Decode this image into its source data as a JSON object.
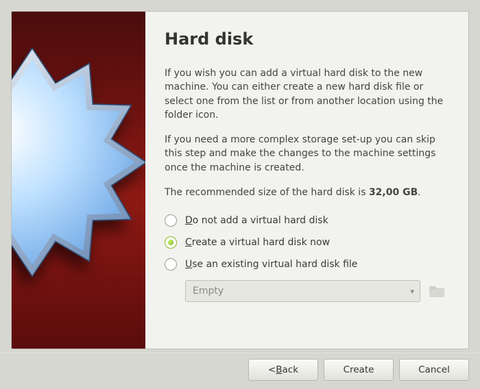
{
  "title": "Hard disk",
  "paragraphs": {
    "p1": "If you wish you can add a virtual hard disk to the new machine. You can either create a new hard disk file or select one from the list or from another location using the folder icon.",
    "p2": "If you need a more complex storage set-up you can skip this step and make the changes to the machine settings once the machine is created.",
    "p3_pre": "The recommended size of the hard disk is ",
    "p3_size": "32,00 GB",
    "p3_post": "."
  },
  "options": {
    "none": "o not add a virtual hard disk",
    "none_accel": "D",
    "create": "reate a virtual hard disk now",
    "create_accel": "C",
    "existing": "se an existing virtual hard disk file",
    "existing_accel": "U",
    "selected": "create"
  },
  "combo": {
    "value": "Empty"
  },
  "buttons": {
    "back_pre": "< ",
    "back_accel": "B",
    "back_rest": "ack",
    "create": "Create",
    "cancel": "Cancel"
  }
}
